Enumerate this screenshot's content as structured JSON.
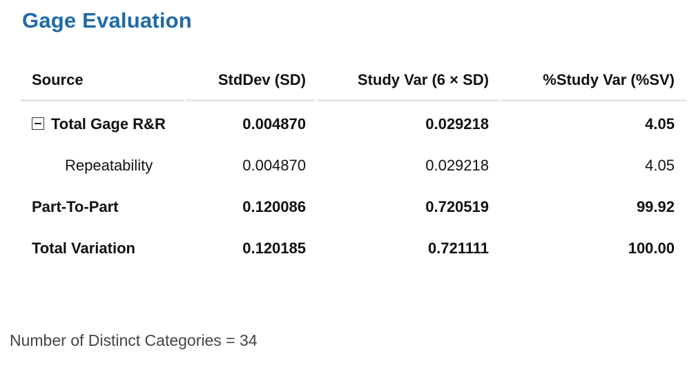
{
  "title": "Gage Evaluation",
  "table": {
    "headers": {
      "source": "Source",
      "stddev": "StdDev (SD)",
      "study_var": "Study Var (6 × SD)",
      "pct_study_var": "%Study Var (%SV)"
    },
    "rows": [
      {
        "source": "Total Gage R&R",
        "stddev": "0.004870",
        "study_var": "0.029218",
        "pct_study_var": "4.05"
      },
      {
        "source": "Repeatability",
        "stddev": "0.004870",
        "study_var": "0.029218",
        "pct_study_var": "4.05"
      },
      {
        "source": "Part-To-Part",
        "stddev": "0.120086",
        "study_var": "0.720519",
        "pct_study_var": "99.92"
      },
      {
        "source": "Total Variation",
        "stddev": "0.120185",
        "study_var": "0.721111",
        "pct_study_var": "100.00"
      }
    ]
  },
  "footer": "Number of Distinct Categories = 34",
  "icons": {
    "collapse": "collapse-toggle-icon"
  },
  "colors": {
    "title": "#1f6aa8",
    "header_rule": "#e6e6e6"
  }
}
